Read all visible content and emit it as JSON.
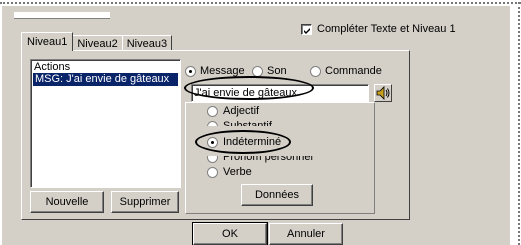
{
  "options": {
    "complete_label": "Compléter Texte et Niveau 1",
    "complete_checked": true
  },
  "tabs": [
    "Niveau1",
    "Niveau2",
    "Niveau3"
  ],
  "actions": {
    "header": "Actions",
    "items": [
      "MSG: J'ai envie de gâteaux"
    ]
  },
  "list_buttons": {
    "new": "Nouvelle",
    "delete": "Supprimer"
  },
  "type_radios": {
    "message": "Message",
    "sound": "Son",
    "command": "Commande",
    "selected": "Message"
  },
  "message_text": "J'ai envie de gâteaux",
  "word_types": [
    "Adjectif",
    "Substantif",
    "Indéterminé",
    "Pronom personnel",
    "Verbe"
  ],
  "word_type_selected": "Indéterminé",
  "data_button": "Données",
  "dialog_buttons": {
    "ok": "OK",
    "cancel": "Annuler"
  }
}
